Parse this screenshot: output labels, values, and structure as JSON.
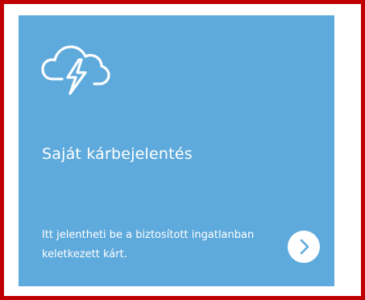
{
  "card": {
    "title": "Saját kárbejelentés",
    "description_line1": "Itt jelentheti be a biztosított ingatlanban",
    "description_line2": "keletkezett kárt.",
    "icon": "cloud-lightning-icon",
    "action_icon": "chevron-right-icon"
  },
  "colors": {
    "card_background": "#5faadc",
    "border": "#c00000",
    "text": "#ffffff",
    "chevron": "#5faadc"
  }
}
